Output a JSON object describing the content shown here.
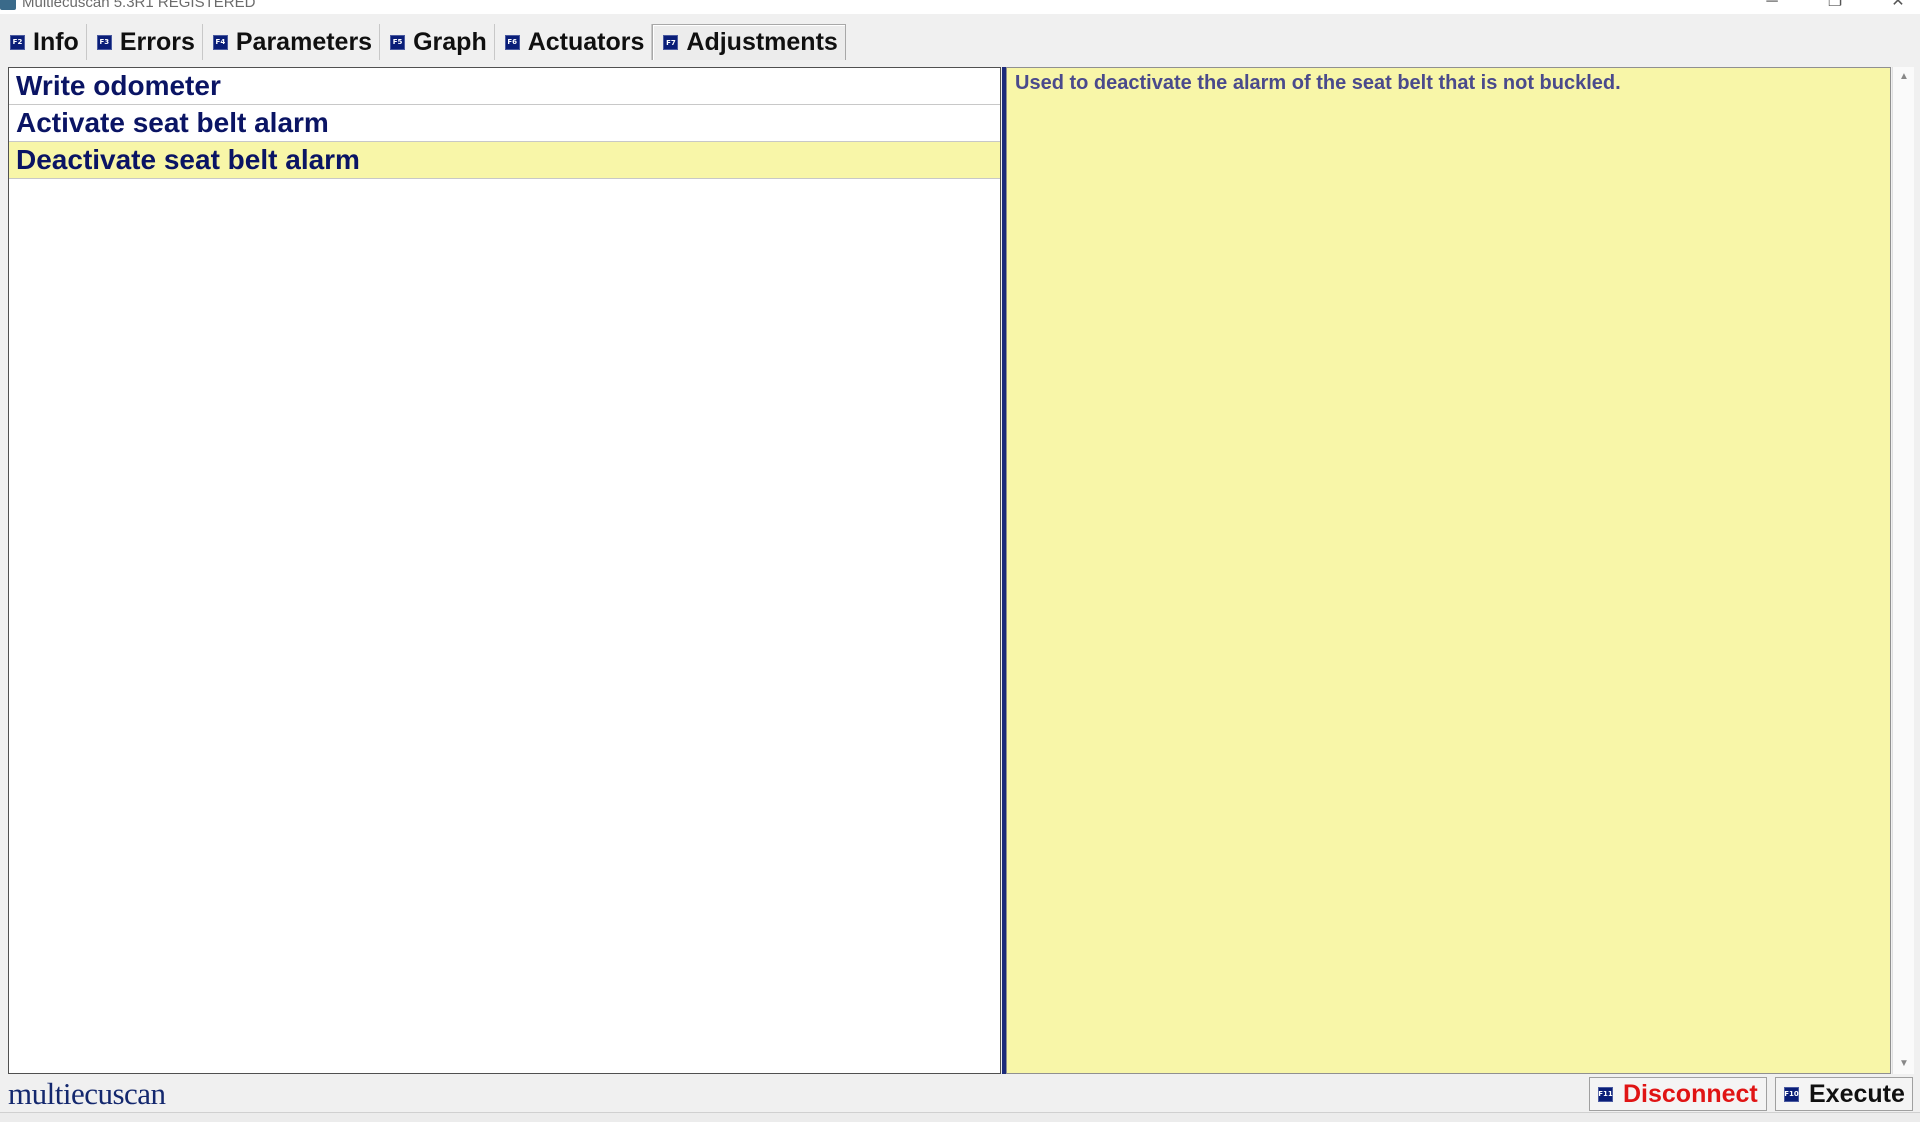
{
  "window": {
    "title": "Multiecuscan 5.3R1 REGISTERED",
    "controls": {
      "minimize": "─",
      "maximize": "❐",
      "close": "✕"
    }
  },
  "tabs": [
    {
      "key": "F2",
      "label": "Info"
    },
    {
      "key": "F3",
      "label": "Errors"
    },
    {
      "key": "F4",
      "label": "Parameters"
    },
    {
      "key": "F5",
      "label": "Graph"
    },
    {
      "key": "F6",
      "label": "Actuators"
    },
    {
      "key": "F7",
      "label": "Adjustments",
      "active": true
    }
  ],
  "adjustments": {
    "items": [
      {
        "label": "Write odometer"
      },
      {
        "label": "Activate seat belt alarm"
      },
      {
        "label": "Deactivate seat belt alarm",
        "selected": true
      }
    ],
    "description": "Used to deactivate the alarm of the seat belt that is not buckled."
  },
  "footer": {
    "logo_text": "multiecuscan",
    "disconnect": {
      "key": "F11",
      "label": "Disconnect"
    },
    "execute": {
      "key": "F10",
      "label": "Execute"
    }
  },
  "colors": {
    "selection_bg": "#f8f6a8",
    "item_text": "#0a1464",
    "disconnect_text": "#e01414",
    "fkey_bg": "#0a1e78"
  }
}
